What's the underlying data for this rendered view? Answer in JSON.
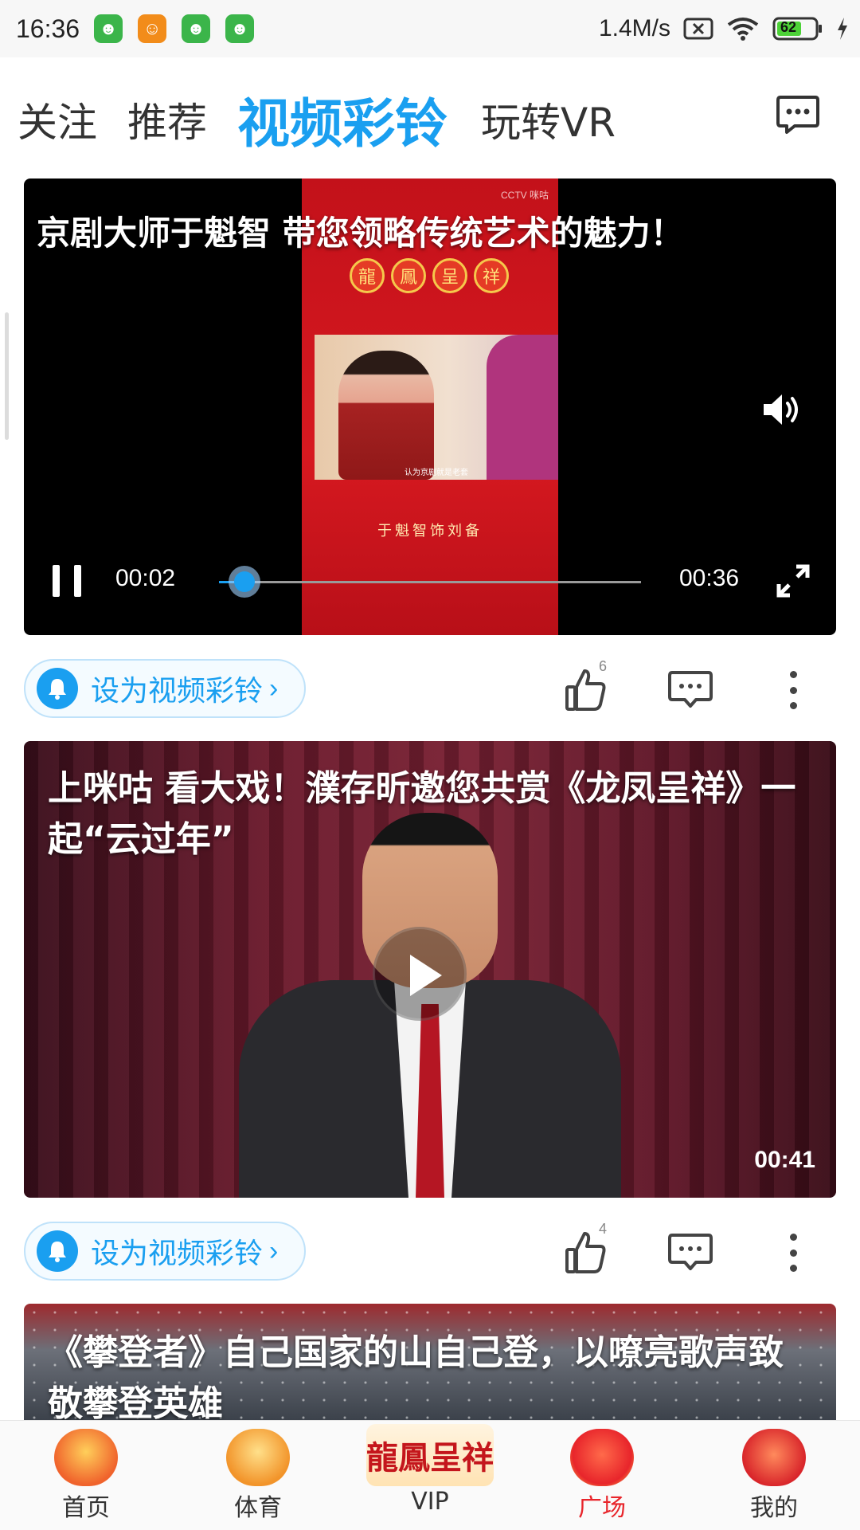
{
  "status_bar": {
    "time": "16:36",
    "net_speed": "1.4M/s",
    "battery": "62",
    "app_icons": [
      {
        "name": "green-app-icon",
        "color": "#3bb54a"
      },
      {
        "name": "orange-app-icon",
        "color": "#f28c1a"
      },
      {
        "name": "green-app-icon",
        "color": "#3bb54a"
      },
      {
        "name": "green-app-icon",
        "color": "#3bb54a"
      }
    ]
  },
  "tabs": {
    "follow": "关注",
    "recommend": "推荐",
    "video_ringtone": "视频彩铃",
    "vr": "玩转VR"
  },
  "feed": [
    {
      "title": "京剧大师于魁智 带您领略传统艺术的魅力！",
      "poster_badge": [
        "龍",
        "鳳",
        "呈",
        "祥"
      ],
      "poster_caption": "于魁智饰刘备",
      "poster_subtitle": "认为京剧就是老套",
      "poster_channel": "CCTV 咪咕",
      "player": {
        "current_time": "00:02",
        "total_time": "00:36",
        "progress": 0.06
      },
      "ring_button": "设为视频彩铃",
      "likes": "6"
    },
    {
      "title": "上咪咕 看大戏！濮存昕邀您共赏《龙凤呈祥》一起“云过年”",
      "duration": "00:41",
      "ring_button": "设为视频彩铃",
      "likes": "4"
    },
    {
      "title": "《攀登者》自己国家的山自己登，以嘹亮歌声致敬攀登英雄"
    }
  ],
  "bottom_nav": [
    {
      "label": "首页",
      "icon": "home-mascot-icon",
      "active": false
    },
    {
      "label": "体育",
      "icon": "sports-mascot-icon",
      "active": false
    },
    {
      "label": "VIP",
      "icon": "vip-logo-icon",
      "logo_text": "龍鳳呈祥",
      "active": false
    },
    {
      "label": "广场",
      "icon": "plaza-firecracker-icon",
      "active": true
    },
    {
      "label": "我的",
      "icon": "profile-mascot-icon",
      "active": false
    }
  ],
  "colors": {
    "accent": "#1a9ff0",
    "active_nav": "#e8252b"
  }
}
